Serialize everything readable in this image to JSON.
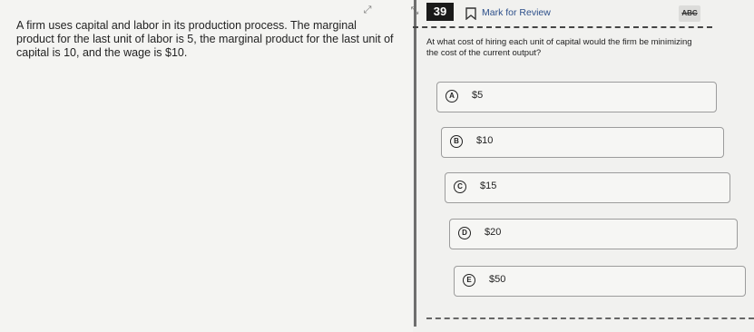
{
  "passage": {
    "text": "A firm uses capital and labor in its production process. The marginal product for the last unit of labor is 5, the marginal product for the last unit of capital is 10, and the wage is $10."
  },
  "header": {
    "question_number": "39",
    "mark_for_review": "Mark for Review",
    "abc_label": "ABC"
  },
  "question": {
    "stem": "At what cost of hiring each unit of capital would the firm be minimizing the cost of the current output?"
  },
  "options": [
    {
      "letter": "A",
      "text": "$5"
    },
    {
      "letter": "B",
      "text": "$10"
    },
    {
      "letter": "C",
      "text": "$15"
    },
    {
      "letter": "D",
      "text": "$20"
    },
    {
      "letter": "E",
      "text": "$50"
    }
  ],
  "colors": {
    "badge_bg": "#1a1a1a",
    "link": "#2c4f8a"
  }
}
